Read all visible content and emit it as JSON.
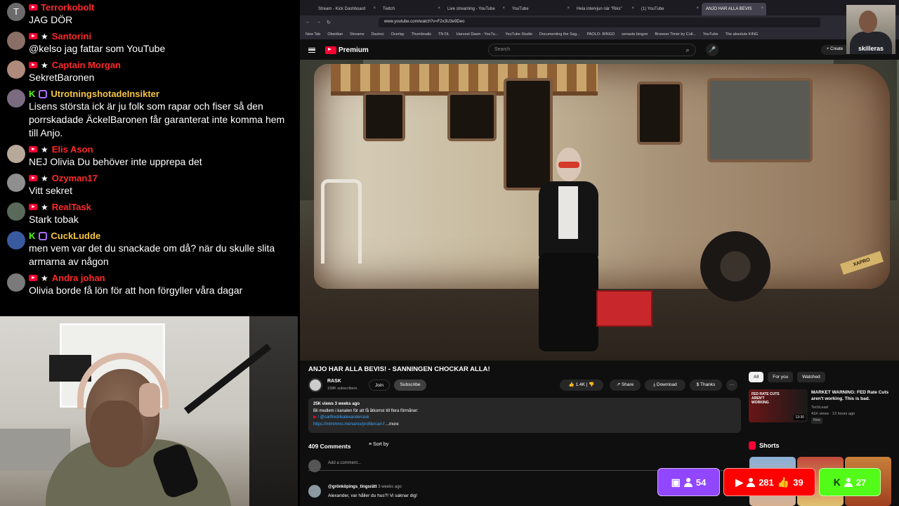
{
  "chat": {
    "messages": [
      {
        "avatar_letter": "T",
        "avatar_color": "#6b6b6b",
        "badges": [
          "youtube"
        ],
        "name": "Terrorkobolt",
        "name_color": "#ff2a2a",
        "text": "JAG DÖR"
      },
      {
        "avatar_letter": "",
        "avatar_color": "#8a6f66",
        "badges": [
          "youtube",
          "star"
        ],
        "name": "Santorini",
        "name_color": "#ff2a2a",
        "text": "@kelso jag fattar som YouTube"
      },
      {
        "avatar_letter": "",
        "avatar_color": "#b08a7a",
        "badges": [
          "youtube",
          "star"
        ],
        "name": "Captain Morgan",
        "name_color": "#ff2a2a",
        "text": "SekretBaronen"
      },
      {
        "avatar_letter": "",
        "avatar_color": "#7a6b80",
        "badges": [
          "kick",
          "twitch"
        ],
        "name": "UtrotningshotadeInsikter",
        "name_color": "#f5c542",
        "text": "Lisens största ick är ju folk som rapar och fiser så den porrskadade ÄckelBaronen får garanterat inte komma hem till Anjo."
      },
      {
        "avatar_letter": "",
        "avatar_color": "#b8a99a",
        "badges": [
          "youtube",
          "star"
        ],
        "name": "Elis Ason",
        "name_color": "#ff2a2a",
        "text": "NEJ Olivia Du behöver inte upprepa det"
      },
      {
        "avatar_letter": "",
        "avatar_color": "#8f8f8f",
        "badges": [
          "youtube",
          "star"
        ],
        "name": "Ozyman17",
        "name_color": "#ff2a2a",
        "text": "Vitt sekret"
      },
      {
        "avatar_letter": "",
        "avatar_color": "#5a6a5a",
        "badges": [
          "youtube",
          "star"
        ],
        "name": "RealTask",
        "name_color": "#ff2a2a",
        "text": "Stark tobak"
      },
      {
        "avatar_letter": "",
        "avatar_color": "#3a5aa0",
        "badges": [
          "kick",
          "twitch"
        ],
        "name": "CuckLudde",
        "name_color": "#f5c542",
        "text": "men vem var det du snackade om då? när du skulle slita armarna av någon"
      },
      {
        "avatar_letter": "",
        "avatar_color": "#7a7a7a",
        "badges": [
          "youtube",
          "star"
        ],
        "name": "Andra johan",
        "name_color": "#ff2a2a",
        "text": "Olivia borde få lön för att hon förgyller våra dagar"
      }
    ]
  },
  "browser": {
    "tabs": [
      {
        "label": "Stream - Kick Dashboard",
        "active": false
      },
      {
        "label": "Twitch",
        "active": false
      },
      {
        "label": "Live streaming - YouTube",
        "active": false
      },
      {
        "label": "YouTube",
        "active": false
      },
      {
        "label": "Hela intervjun när \"Riks\"",
        "active": false
      },
      {
        "label": "(1) YouTube",
        "active": false
      },
      {
        "label": "ANJO HAR ALLA BEVIS",
        "active": true
      }
    ],
    "url": "www.youtube.com/watch?v=F2x3U3e9Deo",
    "bookmarks": [
      "New Tab",
      "Obsidian",
      "Streams",
      "Davinci",
      "Overlay",
      "Thumbnails",
      "TN DL",
      "Harvest Dawn - YouTu...",
      "YouTube Studio",
      "Documenting the Sag...",
      "PAOLO- BINGO",
      "senaste bingon",
      "Browser Timer by Coll...",
      "YouTube",
      "The absolute KING"
    ]
  },
  "youtube": {
    "logo": "Premium",
    "search_placeholder": "Search",
    "create_label": "+ Create",
    "video_plate": "XAPRO",
    "video_title": "ANJO HAR ALLA BEVIS! - SANNINGEN CHOCKAR ALLA!",
    "channel_name": "RASK",
    "channel_subs": "158K subscribers",
    "join_label": "Join",
    "subscribe_label": "Subscribe",
    "likes": "1.4K",
    "share_label": "Share",
    "download_label": "Download",
    "thanks_label": "Thanks",
    "more_dots": "···",
    "desc_views": "25K views  3 weeks ago",
    "desc_line1": "Bli medlem i kanalen för att få åtkomst till flera förmåner:",
    "desc_line2": " / @carlfredrikalexanderrask",
    "desc_link": "https://mimmmo.me/se/sv/profile/carl-f",
    "desc_more": "...more",
    "comments_count": "409 Comments",
    "sort_label": "Sort by",
    "add_comment": "Add a comment...",
    "comment_author": "@grönköpings_tingsrätt",
    "comment_ago": "3 weeks ago",
    "comment_text": "Alexander, var håller du hus?! Vi saknar dig!",
    "chips": [
      {
        "label": "All",
        "on": true
      },
      {
        "label": "For you",
        "on": false
      },
      {
        "label": "Watched",
        "on": false
      }
    ],
    "rec_thumb_text": "FED RATE CUTS AREN'T WORKING",
    "rec_duration": "13:30",
    "rec_title": "MARKET WARNING: FED Rate Cuts aren't working. This is bad.",
    "rec_channel": "TechLead",
    "rec_meta": "41K views · 13 hours ago",
    "rec_new": "New",
    "shorts_label": "Shorts"
  },
  "overlay": {
    "streamer_name": "skilleras",
    "twitch_viewers": "54",
    "youtube_viewers": "281",
    "youtube_likes": "39",
    "kick_viewers": "27"
  }
}
